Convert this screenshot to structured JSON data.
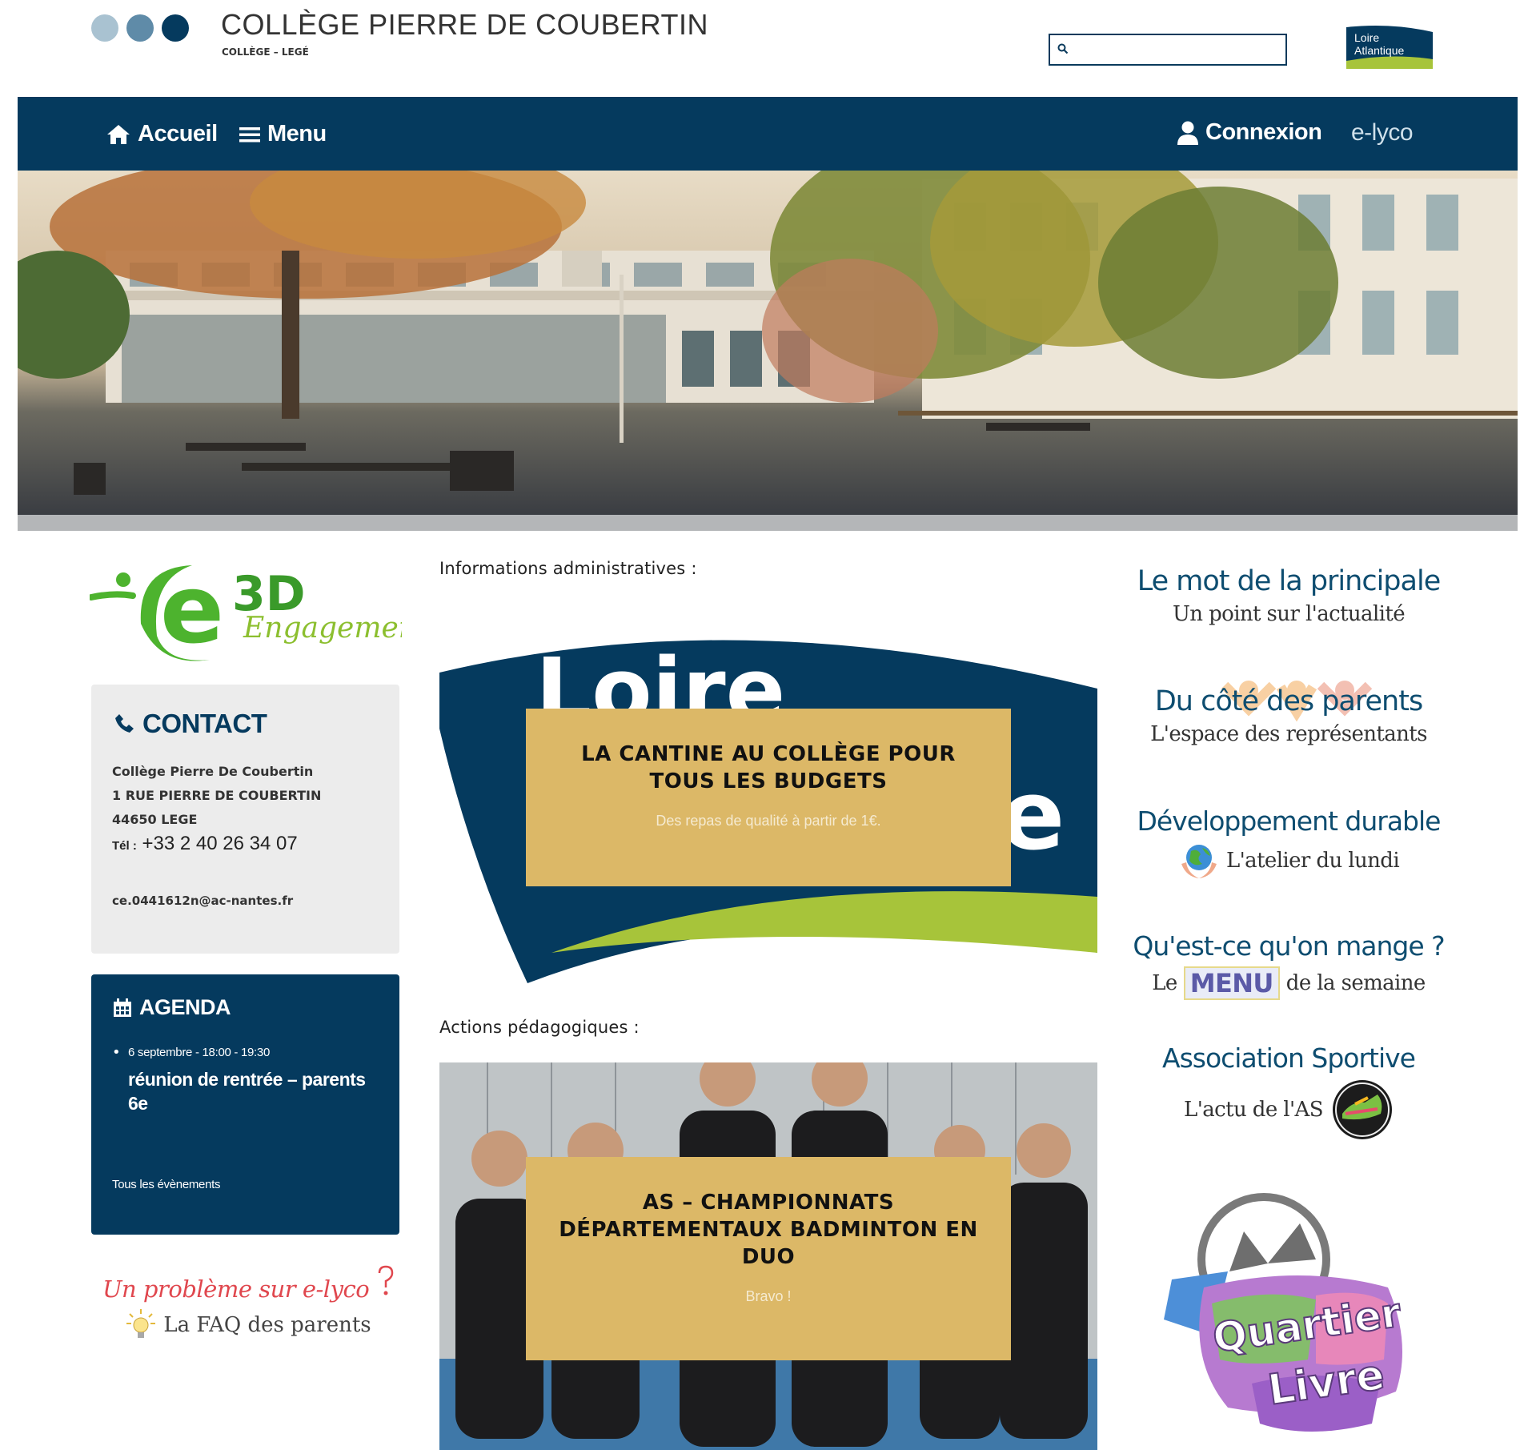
{
  "header": {
    "title": "COLLÈGE PIERRE DE COUBERTIN",
    "subtitle": "COLLÈGE – LEGÉ",
    "search": {
      "placeholder": "",
      "value": ""
    },
    "dept_logo": {
      "line1": "Loire",
      "line2": "Atlantique"
    },
    "dot_colors": [
      "#a9c2d1",
      "#5f8ba8",
      "#053a5e"
    ]
  },
  "nav": {
    "home_label": "Accueil",
    "menu_label": "Menu",
    "login_label": "Connexion",
    "elyco_label": "e-lyco"
  },
  "left": {
    "e3d_logo": {
      "letter": "e",
      "code": "3D",
      "word": "Engagement"
    },
    "contact": {
      "title": "CONTACT",
      "name": "Collège Pierre De Coubertin",
      "street": "1 RUE PIERRE DE COUBERTIN",
      "city": "44650 LEGE",
      "phone_label": "Tél :",
      "phone": "+33 2 40 26 34 07",
      "email": "ce.0441612n@ac-nantes.fr"
    },
    "agenda": {
      "title": "AGENDA",
      "events": [
        {
          "date": "6 septembre - 18:00 - 19:30",
          "title": "réunion de rentrée – parents 6e"
        }
      ],
      "all_label": "Tous les évènements"
    },
    "faq": {
      "title": "Un problème sur e-lyco",
      "subtitle": "La FAQ des parents"
    }
  },
  "main": {
    "admin_heading": "Informations administratives :",
    "news1": {
      "bg_word": "Loire",
      "bg_letter": "e",
      "title": "LA CANTINE AU COLLÈGE POUR TOUS LES BUDGETS",
      "subtitle": "Des repas de qualité à partir de 1€."
    },
    "pedago_heading": "Actions pédagogiques :",
    "news2": {
      "title": "AS – CHAMPIONNATS DÉPARTEMENTAUX BADMINTON EN DUO",
      "subtitle": "Bravo !"
    }
  },
  "right": {
    "links": [
      {
        "title": "Le mot de la principale",
        "subtitle": "Un point sur l'actualité"
      },
      {
        "title": "Du côté des parents",
        "subtitle": "L'espace des représentants"
      },
      {
        "title": "Développement durable",
        "subtitle": "L'atelier du lundi"
      },
      {
        "title": "Qu'est-ce qu'on mange ?",
        "sub_prefix": "Le",
        "sub_highlight": "MENU",
        "sub_suffix": "de la semaine"
      },
      {
        "title": "Association Sportive",
        "subtitle": "L'actu de l'AS"
      }
    ],
    "quartier_livre": {
      "line1": "Quartier",
      "line2": "Livre"
    }
  },
  "colors": {
    "navy": "#053a5e",
    "gold_card": "#dcb867",
    "lime": "#a7c43a",
    "green": "#4db32e",
    "red_link": "#e0474e"
  }
}
